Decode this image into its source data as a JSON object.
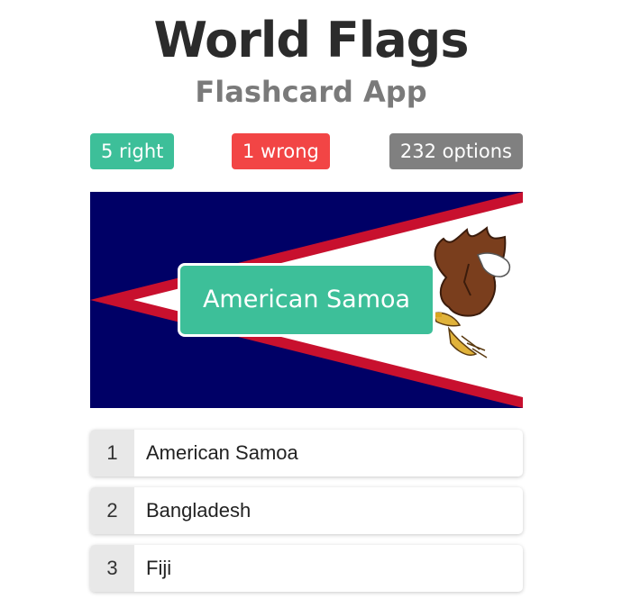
{
  "app": {
    "title": "World Flags",
    "subtitle": "Flashcard App"
  },
  "stats": {
    "right": "5 right",
    "wrong": "1 wrong",
    "options": "232 options"
  },
  "flag": {
    "country": "American Samoa",
    "answer_label": "American Samoa"
  },
  "choices": [
    {
      "number": "1",
      "label": "American Samoa"
    },
    {
      "number": "2",
      "label": "Bangladesh"
    },
    {
      "number": "3",
      "label": "Fiji"
    }
  ],
  "colors": {
    "right": "#3dbf99",
    "wrong": "#f24545",
    "options": "#808080",
    "flag_blue": "#000066",
    "flag_red": "#c8102e",
    "flag_white": "#ffffff"
  }
}
